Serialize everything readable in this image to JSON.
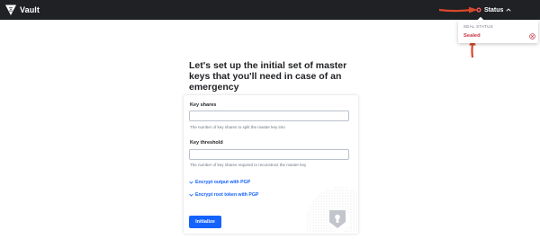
{
  "header": {
    "app_name": "Vault",
    "status_label": "Status"
  },
  "status_menu": {
    "section_title": "SEAL STATUS",
    "seal_value": "Sealed"
  },
  "page": {
    "heading": "Let's set up the initial set of master keys that you'll need in case of an emergency"
  },
  "form": {
    "key_shares": {
      "label": "Key shares",
      "value": "",
      "help": "The number of key shares to split the master key into"
    },
    "key_threshold": {
      "label": "Key threshold",
      "value": "",
      "help": "The number of key shares required to reconstruct the master key"
    },
    "toggles": {
      "encrypt_output": "Encrypt output with PGP",
      "encrypt_root": "Encrypt root token with PGP"
    },
    "submit_label": "Initialize"
  },
  "colors": {
    "topbar": "#1f2124",
    "accent": "#1563ff",
    "sealed": "#c73445",
    "annotation_arrow": "#d9482b"
  }
}
